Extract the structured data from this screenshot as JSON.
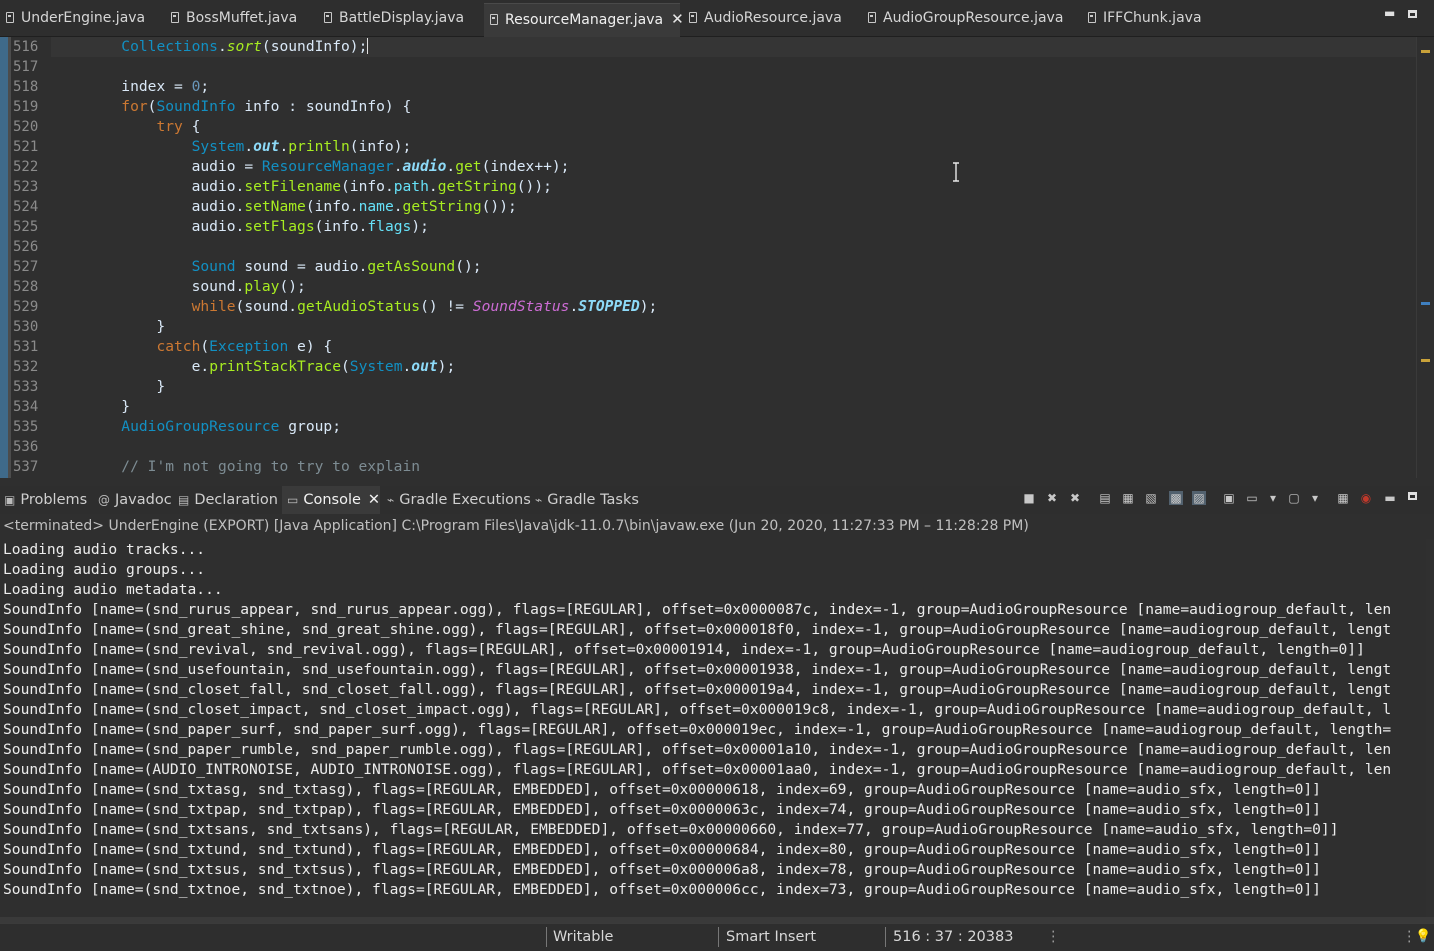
{
  "editor": {
    "tabs": [
      {
        "label": "UnderEngine.java"
      },
      {
        "label": "BossMuffet.java"
      },
      {
        "label": "BattleDisplay.java"
      },
      {
        "label": "ResourceManager.java",
        "active": true,
        "close_glyph": "✕"
      },
      {
        "label": "AudioResource.java"
      },
      {
        "label": "AudioGroupResource.java"
      },
      {
        "label": "IFFChunk.java"
      }
    ],
    "window_minimize_glyph": "▬",
    "line_numbers": [
      "516",
      "517",
      "518",
      "519",
      "520",
      "521",
      "522",
      "523",
      "524",
      "525",
      "526",
      "527",
      "528",
      "529",
      "530",
      "531",
      "532",
      "533",
      "534",
      "535",
      "536",
      "537"
    ],
    "lines": [
      "        Collections.sort(soundInfo);",
      "",
      "        index = 0;",
      "        for(SoundInfo info : soundInfo) {",
      "            try {",
      "                System.out.println(info);",
      "                audio = ResourceManager.audio.get(index++);",
      "                audio.setFilename(info.path.getString());",
      "                audio.setName(info.name.getString());",
      "                audio.setFlags(info.flags);",
      "",
      "                Sound sound = audio.getAsSound();",
      "                sound.play();",
      "                while(sound.getAudioStatus() != SoundStatus.STOPPED);",
      "            }",
      "            catch(Exception e) {",
      "                e.printStackTrace(System.out);",
      "            }",
      "        }",
      "        AudioGroupResource group;",
      "",
      "        // I'm not going to try to explain"
    ],
    "overview_colors": {
      "warning": "#c9a23a",
      "occurrence": "#3f7fbf"
    }
  },
  "views": {
    "tabs": [
      {
        "label": "Problems",
        "icon": "problems-icon"
      },
      {
        "label": "Javadoc",
        "icon": "javadoc-icon"
      },
      {
        "label": "Declaration",
        "icon": "declaration-icon"
      },
      {
        "label": "Console",
        "icon": "console-icon",
        "active": true,
        "close_glyph": "✕"
      },
      {
        "label": "Gradle Executions",
        "icon": "gradle-executions-icon"
      },
      {
        "label": "Gradle Tasks",
        "icon": "gradle-tasks-icon"
      }
    ],
    "toolbar_glyphs": [
      "■",
      "✖",
      "✖",
      "▤",
      "▦",
      "▧",
      "▩",
      "▨",
      "▣",
      "▭",
      "▾",
      "▢",
      "▾",
      "▦",
      "◉",
      "▬"
    ]
  },
  "console": {
    "terminated_label": "<terminated> UnderEngine (EXPORT) [Java Application] C:\\Program Files\\Java\\jdk-11.0.7\\bin\\javaw.exe  (Jun 20, 2020, 11:27:33 PM – 11:28:28 PM)",
    "lines": [
      "Loading audio tracks...",
      "Loading audio groups...",
      "Loading audio metadata...",
      "SoundInfo [name=(snd_rurus_appear, snd_rurus_appear.ogg), flags=[REGULAR], offset=0x0000087c, index=-1, group=AudioGroupResource [name=audiogroup_default, len",
      "SoundInfo [name=(snd_great_shine, snd_great_shine.ogg), flags=[REGULAR], offset=0x000018f0, index=-1, group=AudioGroupResource [name=audiogroup_default, lengt",
      "SoundInfo [name=(snd_revival, snd_revival.ogg), flags=[REGULAR], offset=0x00001914, index=-1, group=AudioGroupResource [name=audiogroup_default, length=0]]",
      "SoundInfo [name=(snd_usefountain, snd_usefountain.ogg), flags=[REGULAR], offset=0x00001938, index=-1, group=AudioGroupResource [name=audiogroup_default, lengt",
      "SoundInfo [name=(snd_closet_fall, snd_closet_fall.ogg), flags=[REGULAR], offset=0x000019a4, index=-1, group=AudioGroupResource [name=audiogroup_default, lengt",
      "SoundInfo [name=(snd_closet_impact, snd_closet_impact.ogg), flags=[REGULAR], offset=0x000019c8, index=-1, group=AudioGroupResource [name=audiogroup_default, l",
      "SoundInfo [name=(snd_paper_surf, snd_paper_surf.ogg), flags=[REGULAR], offset=0x000019ec, index=-1, group=AudioGroupResource [name=audiogroup_default, length=",
      "SoundInfo [name=(snd_paper_rumble, snd_paper_rumble.ogg), flags=[REGULAR], offset=0x00001a10, index=-1, group=AudioGroupResource [name=audiogroup_default, len",
      "SoundInfo [name=(AUDIO_INTRONOISE, AUDIO_INTRONOISE.ogg), flags=[REGULAR], offset=0x00001aa0, index=-1, group=AudioGroupResource [name=audiogroup_default, len",
      "SoundInfo [name=(snd_txtasg, snd_txtasg), flags=[REGULAR, EMBEDDED], offset=0x00000618, index=69, group=AudioGroupResource [name=audio_sfx, length=0]]",
      "SoundInfo [name=(snd_txtpap, snd_txtpap), flags=[REGULAR, EMBEDDED], offset=0x0000063c, index=74, group=AudioGroupResource [name=audio_sfx, length=0]]",
      "SoundInfo [name=(snd_txtsans, snd_txtsans), flags=[REGULAR, EMBEDDED], offset=0x00000660, index=77, group=AudioGroupResource [name=audio_sfx, length=0]]",
      "SoundInfo [name=(snd_txtund, snd_txtund), flags=[REGULAR, EMBEDDED], offset=0x00000684, index=80, group=AudioGroupResource [name=audio_sfx, length=0]]",
      "SoundInfo [name=(snd_txtsus, snd_txtsus), flags=[REGULAR, EMBEDDED], offset=0x000006a8, index=78, group=AudioGroupResource [name=audio_sfx, length=0]]",
      "SoundInfo [name=(snd_txtnoe, snd_txtnoe), flags=[REGULAR, EMBEDDED], offset=0x000006cc, index=73, group=AudioGroupResource [name=audio_sfx, length=0]]"
    ]
  },
  "status": {
    "writable": "Writable",
    "insert_mode": "Smart Insert",
    "position": "516 : 37 : 20383"
  }
}
